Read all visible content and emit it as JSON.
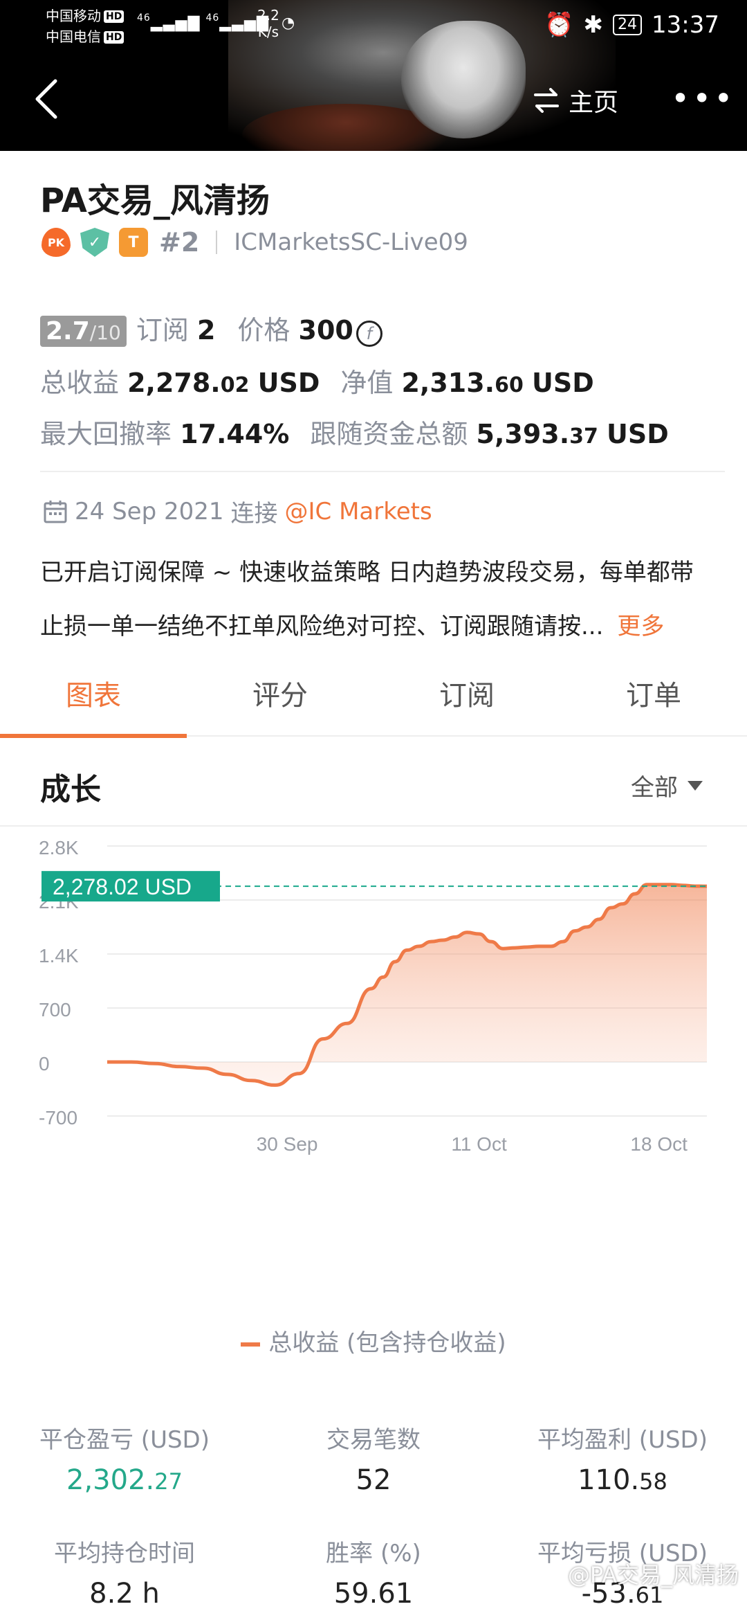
{
  "status_bar": {
    "carrier1": "中国移动",
    "carrier2": "中国电信",
    "hd": "HD",
    "net1": "46",
    "net2": "46",
    "speed_value": "2.2",
    "speed_unit": "K/s",
    "battery": "24",
    "time": "13:37"
  },
  "nav": {
    "home_label": "主页"
  },
  "profile": {
    "title": "PA交易_风清扬",
    "pk_badge": "PK",
    "t_badge": "T",
    "rank": "#2",
    "server": "ICMarketsSC-Live09"
  },
  "metrics": {
    "score": "2.7",
    "score_den": "/10",
    "subs_label": "订阅",
    "subs_value": "2",
    "price_label": "价格",
    "price_value": "300",
    "coin_symbol": "f",
    "total_label": "总收益",
    "total_int": "2,278.",
    "total_dec": "02",
    "total_unit": "USD",
    "equity_label": "净值",
    "equity_int": "2,313.",
    "equity_dec": "60",
    "equity_unit": "USD",
    "dd_label": "最大回撤率",
    "dd_value": "17.44%",
    "follow_label": "跟随资金总额",
    "follow_int": "5,393.",
    "follow_dec": "37",
    "follow_unit": "USD"
  },
  "connection": {
    "date": "24 Sep 2021",
    "label": "连接",
    "broker": "@IC Markets"
  },
  "description": {
    "line1": "已开启订阅保障 ~ 快速收益策略 日内趋势波段交易，每单都带",
    "line2": "止损一单一结绝不扛单风险绝对可控、订阅跟随请按...",
    "more": "更多"
  },
  "tabs": [
    "图表",
    "评分",
    "订阅",
    "订单"
  ],
  "section": {
    "title": "成长",
    "filter": "全部"
  },
  "colors": {
    "accent": "#f0753a",
    "line": "#ef7a48",
    "fill": "#fbd3c2",
    "marker": "#17a88b",
    "positive": "#24a88a"
  },
  "chart_data": {
    "type": "area",
    "y_ticks": [
      "2.8K",
      "2.1K",
      "1.4K",
      "700",
      "0",
      "-700"
    ],
    "y_tick_values": [
      2800,
      2100,
      1400,
      700,
      0,
      -700
    ],
    "ylim": [
      -700,
      2800
    ],
    "x_ticks": [
      "30 Sep",
      "11 Oct",
      "18 Oct"
    ],
    "marker_label": "2,278.02 USD",
    "marker_value": 2278.02,
    "series": [
      {
        "name": "总收益 (包含持仓收益)",
        "x": [
          0,
          4,
          8,
          12,
          16,
          20,
          24,
          28,
          32,
          36,
          40,
          44,
          46,
          48,
          50,
          52,
          54,
          56,
          58,
          60,
          62,
          64,
          66,
          68,
          70,
          72,
          74,
          76,
          78,
          80,
          82,
          84,
          86,
          88,
          90,
          92,
          94,
          96,
          98,
          100
        ],
        "values": [
          0,
          0,
          -20,
          -60,
          -80,
          -160,
          -240,
          -300,
          -150,
          300,
          500,
          950,
          1100,
          1300,
          1450,
          1500,
          1560,
          1580,
          1620,
          1680,
          1660,
          1560,
          1470,
          1480,
          1490,
          1500,
          1500,
          1560,
          1700,
          1750,
          1850,
          2000,
          2050,
          2180,
          2300,
          2300,
          2300,
          2290,
          2280,
          2278
        ]
      }
    ]
  },
  "legend": {
    "label": "总收益 (包含持仓收益)"
  },
  "stats": {
    "closed_pl_label": "平仓盈亏 (USD)",
    "closed_pl_int": "2,302.",
    "closed_pl_dec": "27",
    "trades_label": "交易笔数",
    "trades_value": "52",
    "avg_profit_label": "平均盈利 (USD)",
    "avg_profit_int": "110.",
    "avg_profit_dec": "58",
    "hold_label": "平均持仓时间",
    "hold_value": "8.2 h",
    "winrate_label": "胜率 (%)",
    "winrate_value": "59.61",
    "avg_loss_label": "平均亏损 (USD)",
    "avg_loss_int": "-53.",
    "avg_loss_dec": "61"
  },
  "watermark": "@PA交易_风清扬"
}
